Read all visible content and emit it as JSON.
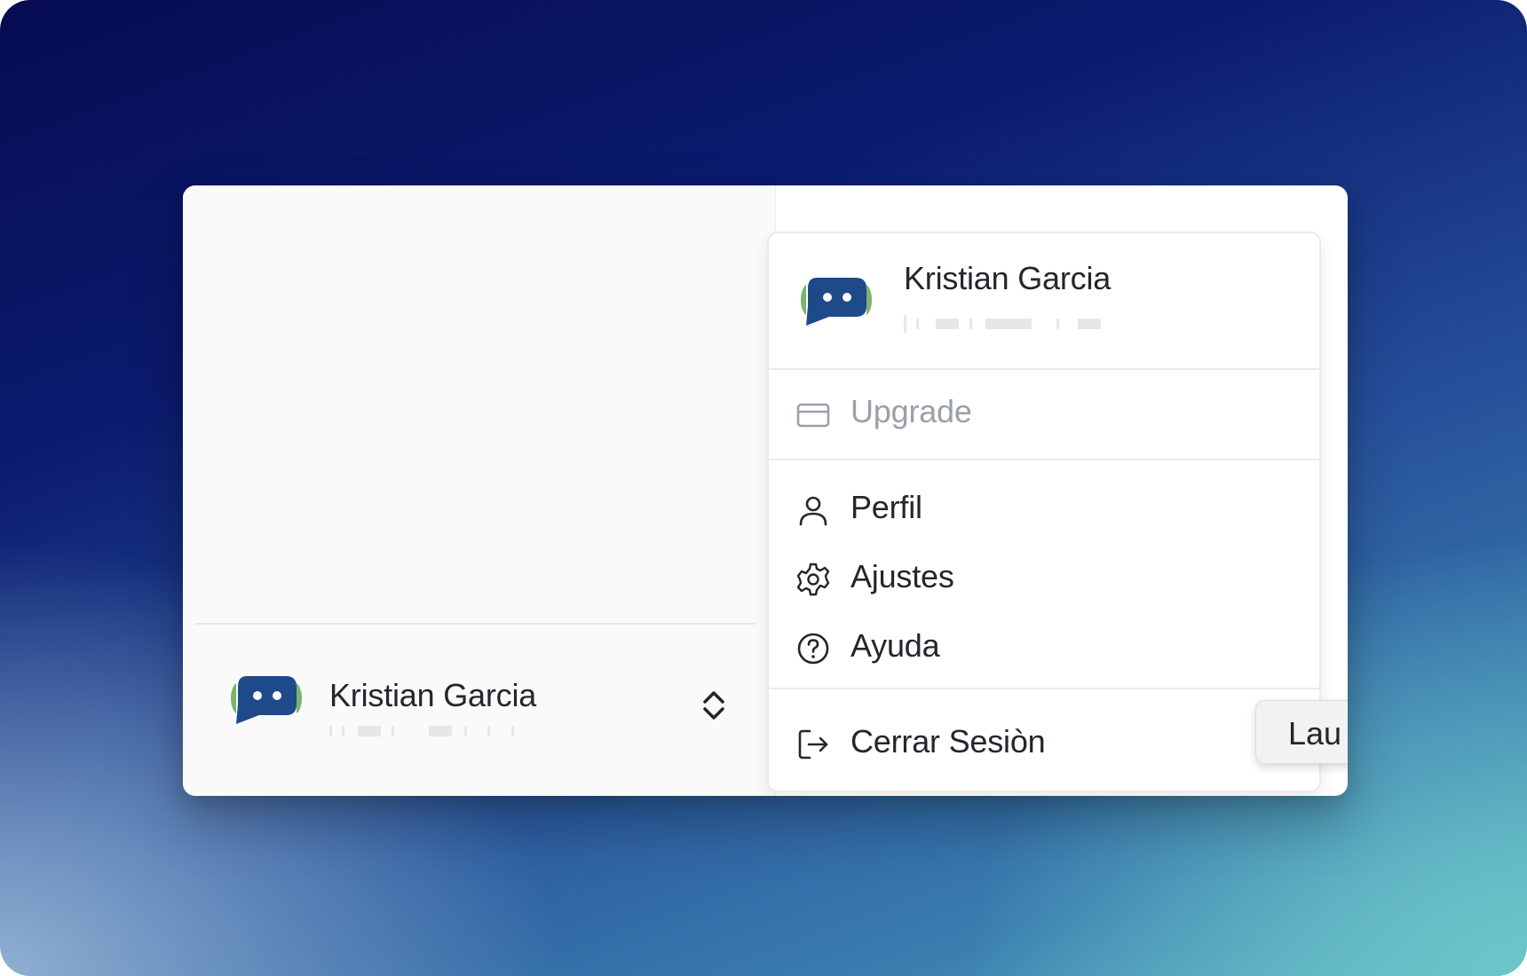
{
  "colors": {
    "brand_blue": "#1e4a8a",
    "brand_green": "#7bb46a",
    "text_primary": "#23262b",
    "text_disabled": "#9aa0aa",
    "divider": "#e9eaec"
  },
  "sidebar": {
    "account": {
      "name": "Kristian Garcia",
      "logo_icon": "chat-bot-logo-icon",
      "toggle_icon": "chevron-up-down-icon"
    }
  },
  "account_menu": {
    "header": {
      "name": "Kristian Garcia",
      "logo_icon": "chat-bot-logo-icon"
    },
    "upgrade": {
      "label": "Upgrade",
      "icon": "credit-card-icon",
      "state": "disabled"
    },
    "items": [
      {
        "label": "Perfil",
        "icon": "user-icon"
      },
      {
        "label": "Ajustes",
        "icon": "gear-icon"
      },
      {
        "label": "Ayuda",
        "icon": "help-circle-icon"
      }
    ],
    "logout": {
      "label": "Cerrar Sesiòn",
      "icon": "logout-icon"
    }
  },
  "tooltip": {
    "text": "Lau"
  }
}
